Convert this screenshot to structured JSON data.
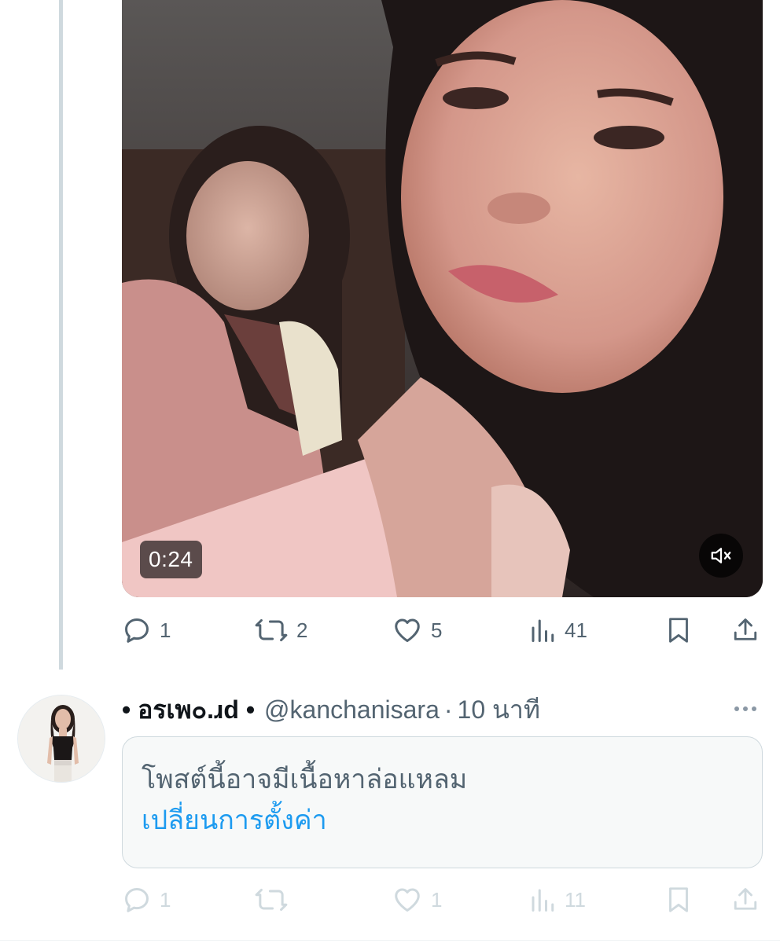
{
  "video": {
    "duration": "0:24",
    "mute_icon": "speaker-muted-icon"
  },
  "top_actions": {
    "replies": "1",
    "reposts": "2",
    "likes": "5",
    "views": "41"
  },
  "reply_tweet": {
    "display_name": "• อรเพ๐.ɹd •",
    "handle": "@kanchanisara",
    "separator": "·",
    "time": "10 นาที",
    "sensitive_notice": "โพสต์นี้อาจมีเนื้อหาล่อแหลม",
    "change_settings_link": "เปลี่ยนการตั้งค่า",
    "actions": {
      "replies": "1",
      "reposts": "",
      "likes": "1",
      "views": "11"
    }
  },
  "colors": {
    "thread_line": "#cfd9de",
    "secondary_text": "#536471",
    "link": "#1d9bf0",
    "faded_icon": "#cfd9de"
  }
}
